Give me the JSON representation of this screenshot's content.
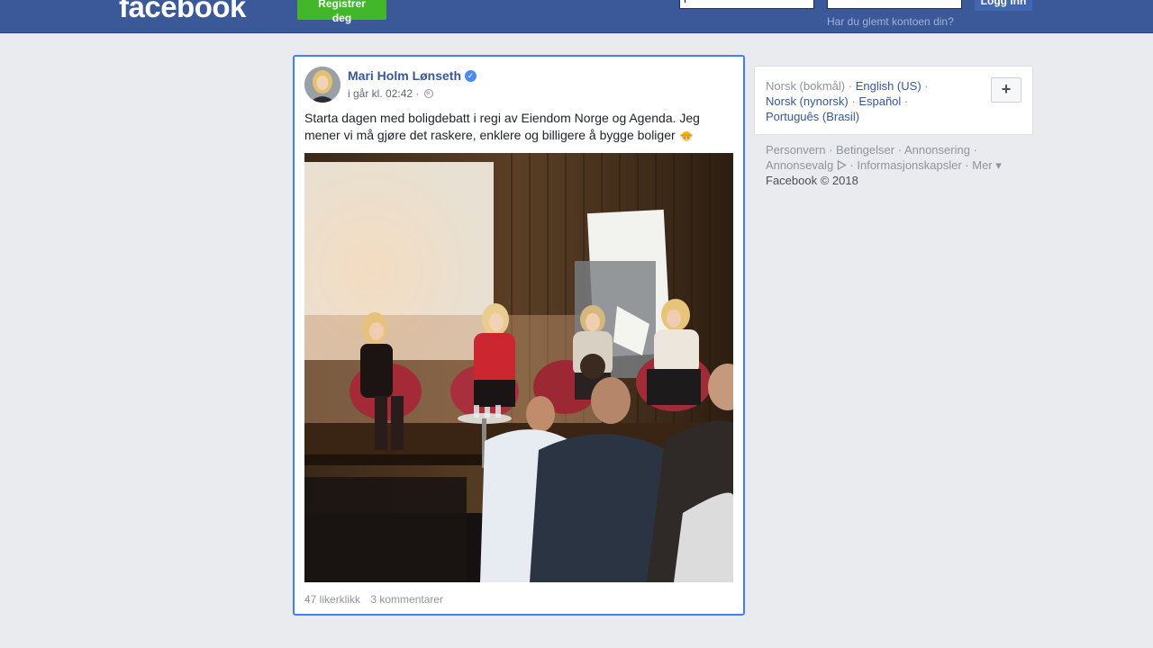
{
  "header": {
    "logo": "facebook",
    "register_label": "Registrer deg",
    "email_value": "",
    "password_value": "",
    "login_label": "Logg inn",
    "forgot_label": "Har du glemt kontoen din?"
  },
  "post": {
    "author": "Mari Holm Lønseth",
    "timestamp": "i går kl. 02:42 ·",
    "text": "Starta dagen med boligdebatt i regi av Eiendom Norge og Agenda. Jeg mener vi må gjøre det raskere, enklere og billigere å bygge boliger",
    "likes": "47 likerklikk",
    "comments": "3 kommentarer"
  },
  "languages": {
    "current": "Norsk (bokmål)",
    "options": [
      "English (US)",
      "Norsk (nynorsk)",
      "Español",
      "Português (Brasil)"
    ],
    "more_label": "+"
  },
  "footer": {
    "links": [
      "Personvern",
      "Betingelser",
      "Annonsering",
      "Annonsevalg",
      "Informasjonskapsler",
      "Mer"
    ],
    "copyright": "Facebook © 2018"
  },
  "colors": {
    "brand": "#3b5998",
    "register_green": "#42b72a",
    "link": "#365899",
    "focus_border": "#4080ff"
  }
}
